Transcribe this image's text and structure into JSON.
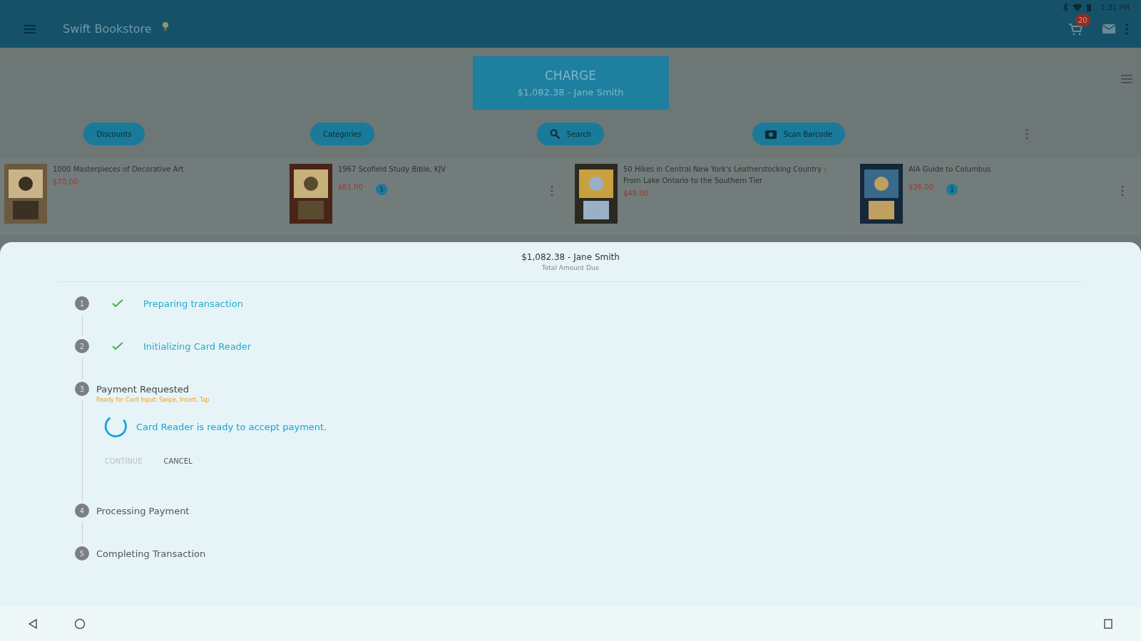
{
  "status_bar": {
    "time": "1:31 PM"
  },
  "app_bar": {
    "title": "Swift Bookstore",
    "cart_count": "20"
  },
  "charge": {
    "label": "CHARGE",
    "amount": "$1,082.38 - Jane Smith"
  },
  "toolbar": [
    {
      "label": "Discounts",
      "kind": "plain"
    },
    {
      "label": "Categories",
      "kind": "plain"
    },
    {
      "label": "Search",
      "kind": "search"
    },
    {
      "label": "Scan Barcode",
      "kind": "camera"
    }
  ],
  "books": [
    {
      "title": "1000 Masterpieces of Decorative Art",
      "price": "$70.00"
    },
    {
      "title": "1967 Scofield Study Bible, KJV",
      "price": "$81.00",
      "count": "1"
    },
    {
      "title": "50 Hikes in Central New York's Leatherstocking Country : From Lake Ontario to the Southern Tier",
      "price": "$49.00"
    },
    {
      "title": "AIA Guide to Columbus",
      "price": "$36.00",
      "count": "1"
    }
  ],
  "sheet": {
    "amount": "$1,082.38 - Jane Smith",
    "caption": "Total Amount Due",
    "steps": [
      {
        "number": "1",
        "label": "Preparing transaction",
        "kind": "done"
      },
      {
        "number": "2",
        "label": "Initializing Card Reader",
        "kind": "done"
      },
      {
        "number": "3",
        "label": "Payment Requested",
        "kind": "active",
        "subtitle": "Ready for Card Input: Swipe, Insert, Tap",
        "message": "Card Reader is ready to accept payment.",
        "buttons": [
          {
            "label": "CONTINUE",
            "disabled": true
          },
          {
            "label": "CANCEL",
            "disabled": false
          }
        ]
      },
      {
        "number": "4",
        "label": "Processing Payment",
        "kind": "pending"
      },
      {
        "number": "5",
        "label": "Completing Transaction",
        "kind": "pending"
      }
    ]
  }
}
